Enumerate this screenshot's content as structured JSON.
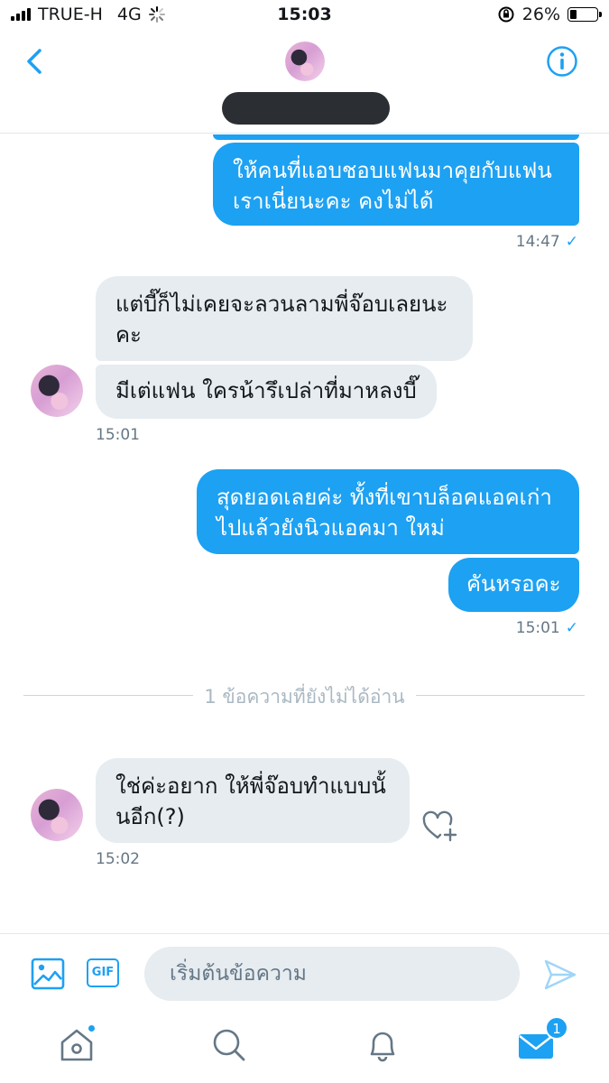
{
  "status_bar": {
    "carrier": "TRUE-H",
    "network": "4G",
    "time": "15:03",
    "battery_percent": "26%",
    "battery_level": 0.26
  },
  "header": {
    "back_icon": "chevron-left-icon",
    "info_icon": "info-icon",
    "accent_color": "#1da1f2"
  },
  "messages": [
    {
      "direction": "out",
      "text_lines": [
        "ให้คนที่แอบชอบแฟนมาคุยกับแฟน",
        "เราเนี่ยนะคะ คงไม่ได้"
      ]
    },
    {
      "timestamp": "14:47",
      "read_icon": "✓"
    },
    {
      "direction": "in",
      "text_lines": [
        "แต่บี๊ก็ไม่เคยจะลวนลามพี่จ๊อบเลยนะ",
        "คะ"
      ]
    },
    {
      "direction": "in",
      "text_lines": [
        "มีเต่แฟน ใครน้ารึเปล่าที่มาหลงบี๊"
      ]
    },
    {
      "timestamp": "15:01"
    },
    {
      "direction": "out",
      "text_lines": [
        "สุดยอดเลยค่ะ ทั้งที่เขาบล็อคแอคเก่า",
        "ไปแล้วยังนิวแอคมา ใหม่"
      ]
    },
    {
      "direction": "out",
      "text_lines": [
        "คันหรอคะ"
      ]
    },
    {
      "timestamp": "15:01",
      "read_icon": "✓"
    },
    {
      "direction": "in",
      "text_lines": [
        "ใช่ค่ะอยาก ให้พี่จ๊อบทำแบบนั้",
        "นอีก(?)"
      ]
    },
    {
      "timestamp": "15:02"
    }
  ],
  "unread_divider": "1 ข้อความที่ยังไม่ได้อ่าน",
  "composer": {
    "media_icon": "image-icon",
    "gif_label": "GIF",
    "placeholder": "เริ่มต้นข้อความ",
    "send_icon": "send-icon"
  },
  "tabbar": {
    "home_icon": "home-icon",
    "search_icon": "search-icon",
    "notifications_icon": "bell-icon",
    "messages_icon": "mail-icon",
    "messages_badge": "1"
  }
}
